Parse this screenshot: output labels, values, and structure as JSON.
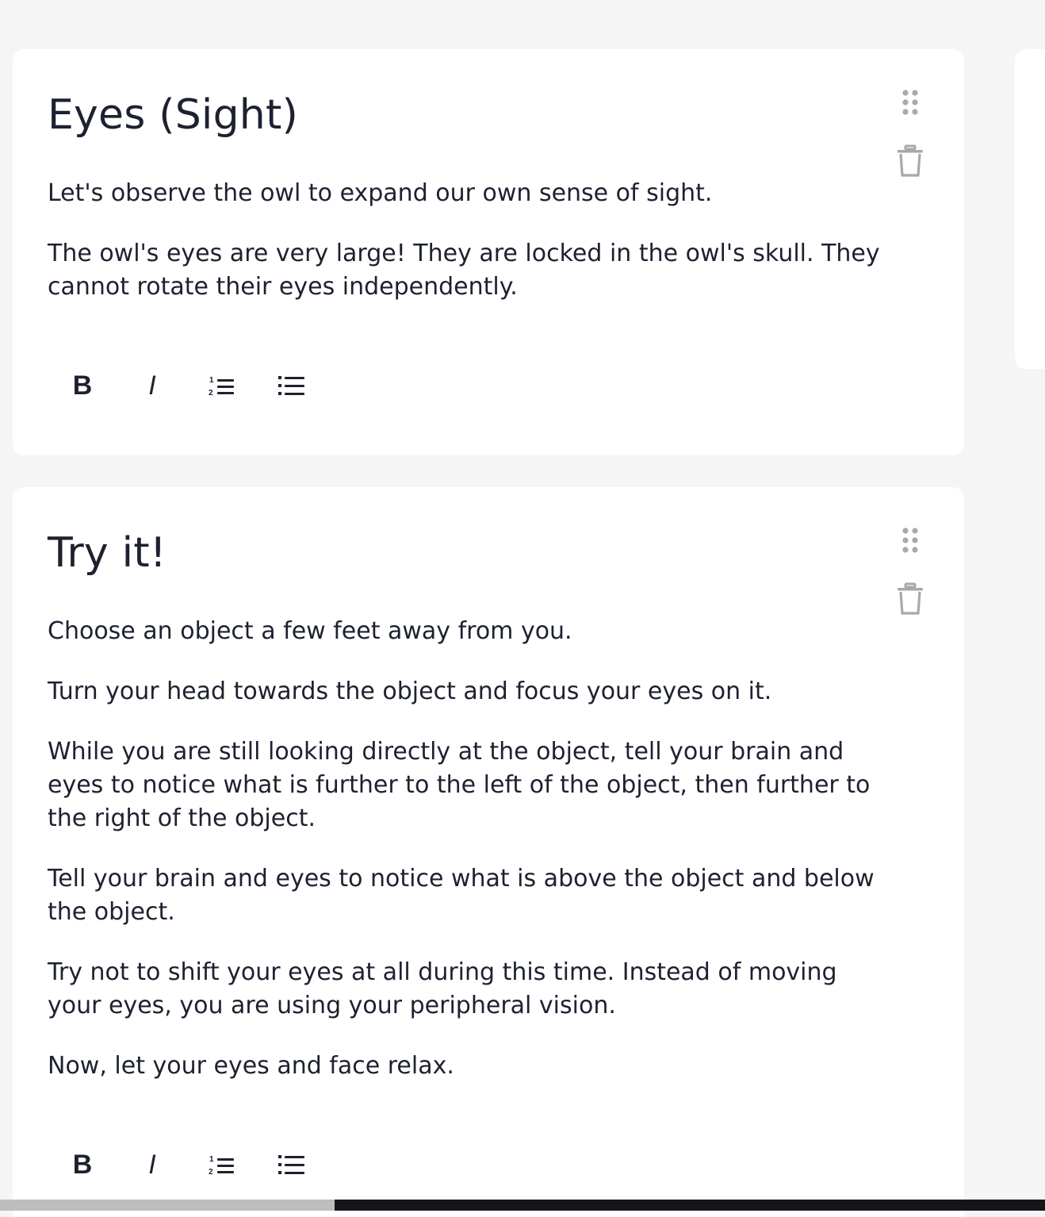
{
  "cards": [
    {
      "title": "Eyes (Sight)",
      "paragraphs": [
        "Let's observe the owl to expand our own sense of sight.",
        "The owl's eyes are very large! They are locked in the owl's skull. They cannot rotate their eyes independently."
      ]
    },
    {
      "title": "Try it!",
      "paragraphs": [
        "Choose an object a few feet away from you.",
        "Turn your head towards the object and focus your eyes on it.",
        "While you are still looking directly at the object, tell your brain and eyes to notice what is further to the left of the object, then further to the right of the object.",
        "Tell your brain and eyes to notice what is above the object and below the object.",
        "Try not to shift your eyes at all during this time. Instead of moving your eyes, you are using your peripheral vision.",
        "Now, let your eyes and face relax."
      ]
    }
  ],
  "toolbar": {
    "bold_label": "B",
    "italic_label": "I",
    "ordered_list_icon": "numbered-list-icon",
    "bullet_list_icon": "bulleted-list-icon"
  },
  "icons": {
    "drag": "drag-handle-icon",
    "delete": "trash-icon"
  },
  "colors": {
    "background": "#f5f5f5",
    "card": "#ffffff",
    "text": "#1d2130",
    "icon_gray": "#a9a9a9"
  }
}
